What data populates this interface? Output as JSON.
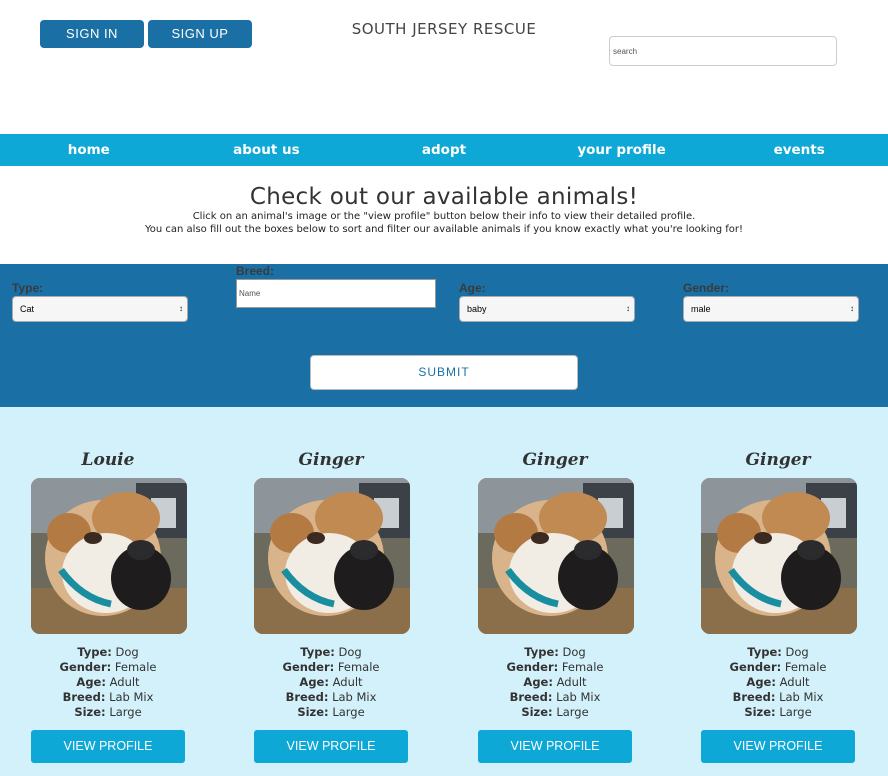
{
  "header": {
    "sign_in": "SIGN IN",
    "sign_up": "SIGN UP",
    "title": "SOUTH JERSEY RESCUE",
    "search_placeholder": "search"
  },
  "nav": [
    "home",
    "about us",
    "adopt",
    "your profile",
    "events"
  ],
  "intro": {
    "heading": "Check out our available animals!",
    "line1": "Click on an animal's image or the \"view profile\" button below their info to view their detailed profile.",
    "line2": "You can also fill out the boxes below to sort and filter our available animals if you know exactly what you're looking for!"
  },
  "filters": {
    "type_label": "Type:",
    "type_value": "Cat",
    "breed_label": "Breed:",
    "breed_placeholder": "Name",
    "age_label": "Age:",
    "age_value": "baby",
    "gender_label": "Gender:",
    "gender_value": "male",
    "submit": "SUBMIT"
  },
  "field_labels": {
    "type": "Type:",
    "gender": "Gender:",
    "age": "Age:",
    "breed": "Breed:",
    "size": "Size:"
  },
  "animals": [
    {
      "name": "Louie",
      "type": "Dog",
      "gender": "Female",
      "age": "Adult",
      "breed": "Lab Mix",
      "size": "Large",
      "button": "VIEW PROFILE"
    },
    {
      "name": "Ginger",
      "type": "Dog",
      "gender": "Female",
      "age": "Adult",
      "breed": "Lab Mix",
      "size": "Large",
      "button": "VIEW PROFILE"
    },
    {
      "name": "Ginger",
      "type": "Dog",
      "gender": "Female",
      "age": "Adult",
      "breed": "Lab Mix",
      "size": "Large",
      "button": "VIEW PROFILE"
    },
    {
      "name": "Ginger",
      "type": "Dog",
      "gender": "Female",
      "age": "Adult",
      "breed": "Lab Mix",
      "size": "Large",
      "button": "VIEW PROFILE"
    }
  ],
  "colors": {
    "primary_blue": "#1a70a5",
    "nav_cyan": "#0ea8d6",
    "card_bg": "#d3f1fb"
  }
}
